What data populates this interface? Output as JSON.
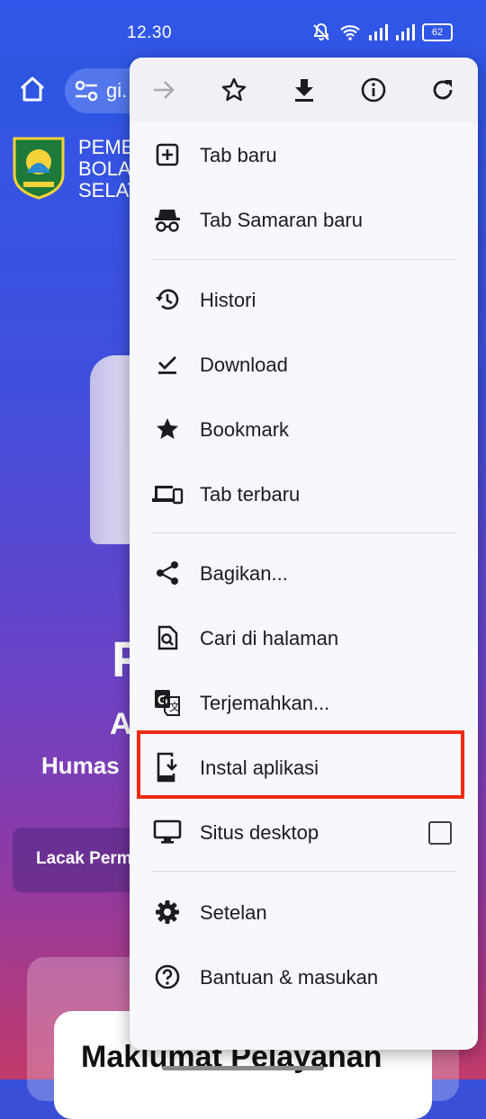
{
  "status_bar": {
    "time": "12.30",
    "battery": "62"
  },
  "browser": {
    "url_text": "gi."
  },
  "page": {
    "org_lines": [
      "PEME",
      "BOLA",
      "SELAT"
    ],
    "hero_letter": "F",
    "hero_a": "A",
    "hero_humas": "Humas",
    "track_button": "Lacak Perm",
    "card_title": "Maklumat Pelayanan"
  },
  "menu": {
    "actions": [
      "forward-icon",
      "star-icon",
      "download-icon",
      "info-icon",
      "refresh-icon"
    ],
    "items": [
      {
        "label": "Tab baru",
        "icon": "new-tab-icon"
      },
      {
        "label": "Tab Samaran baru",
        "icon": "incognito-icon"
      },
      {
        "label": "Histori",
        "icon": "history-icon"
      },
      {
        "label": "Download",
        "icon": "download-done-icon"
      },
      {
        "label": "Bookmark",
        "icon": "bookmark-star-icon"
      },
      {
        "label": "Tab terbaru",
        "icon": "devices-icon"
      },
      {
        "label": "Bagikan...",
        "icon": "share-icon"
      },
      {
        "label": "Cari di halaman",
        "icon": "find-in-page-icon"
      },
      {
        "label": "Terjemahkan...",
        "icon": "translate-icon"
      },
      {
        "label": "Instal aplikasi",
        "icon": "install-app-icon"
      },
      {
        "label": "Situs desktop",
        "icon": "desktop-icon",
        "checked": false
      },
      {
        "label": "Setelan",
        "icon": "settings-icon"
      },
      {
        "label": "Bantuan & masukan",
        "icon": "help-icon"
      }
    ]
  },
  "colors": {
    "highlight": "#ef2a12",
    "toolbar": "#2e56e3",
    "menu_bg": "#f8f7fc"
  }
}
